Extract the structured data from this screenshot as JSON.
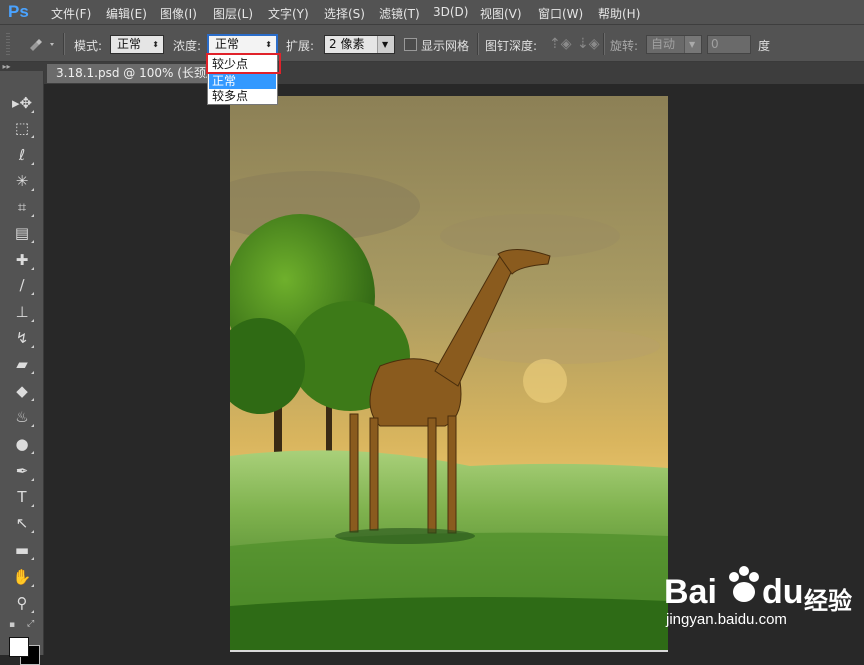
{
  "app": {
    "logo_text": "Ps",
    "brand_color": "#4aa3ff"
  },
  "menu": {
    "items": [
      {
        "label": "文件(F)"
      },
      {
        "label": "编辑(E)"
      },
      {
        "label": "图像(I)"
      },
      {
        "label": "图层(L)"
      },
      {
        "label": "文字(Y)"
      },
      {
        "label": "选择(S)"
      },
      {
        "label": "滤镜(T)"
      },
      {
        "label": "3D(D)"
      },
      {
        "label": "视图(V)"
      },
      {
        "label": "窗口(W)"
      },
      {
        "label": "帮助(H)"
      }
    ]
  },
  "options": {
    "tool_icon": "pin-tool-icon",
    "mode_label": "模式:",
    "mode_value": "正常",
    "density_label": "浓度:",
    "density_value": "正常",
    "expand_label": "扩展:",
    "expand_value": "2 像素",
    "show_grid_label": "显示网格",
    "pin_depth_label": "图钉深度:",
    "rotate_label": "旋转:",
    "rotate_value": "自动",
    "angle_value": "0",
    "angle_unit": "度"
  },
  "density_dropdown": {
    "options": [
      {
        "label": "较少点",
        "highlighted_box": true
      },
      {
        "label": "正常",
        "selected": true
      },
      {
        "label": "较多点"
      }
    ],
    "highlight_color": "#e0222a",
    "selection_color": "#3399ff"
  },
  "document": {
    "tab_title": "3.18.1.psd @ 100% (长颈鹿"
  },
  "toolbar": {
    "tools": [
      {
        "name": "move-tool-icon",
        "glyph": "▸✥"
      },
      {
        "name": "marquee-tool-icon",
        "glyph": "⬚"
      },
      {
        "name": "lasso-tool-icon",
        "glyph": "ℓ"
      },
      {
        "name": "magic-wand-tool-icon",
        "glyph": "✳"
      },
      {
        "name": "crop-tool-icon",
        "glyph": "⌗"
      },
      {
        "name": "eyedropper-tool-icon",
        "glyph": "▤"
      },
      {
        "name": "healing-brush-tool-icon",
        "glyph": "✚"
      },
      {
        "name": "brush-tool-icon",
        "glyph": "∕"
      },
      {
        "name": "stamp-tool-icon",
        "glyph": "⊥"
      },
      {
        "name": "history-brush-tool-icon",
        "glyph": "↯"
      },
      {
        "name": "eraser-tool-icon",
        "glyph": "▰"
      },
      {
        "name": "paint-bucket-tool-icon",
        "glyph": "◆"
      },
      {
        "name": "blur-tool-icon",
        "glyph": "♨"
      },
      {
        "name": "dodge-tool-icon",
        "glyph": "●"
      },
      {
        "name": "pen-tool-icon",
        "glyph": "✒"
      },
      {
        "name": "type-tool-icon",
        "glyph": "T"
      },
      {
        "name": "path-selection-tool-icon",
        "glyph": "↖"
      },
      {
        "name": "rectangle-tool-icon",
        "glyph": "▬"
      },
      {
        "name": "hand-tool-icon",
        "glyph": "✋"
      },
      {
        "name": "zoom-tool-icon",
        "glyph": "⚲"
      }
    ],
    "foreground_color": "#ffffff",
    "background_color": "#000000"
  },
  "watermark": {
    "brand": "Bai",
    "brand2": "du",
    "cn": "经验",
    "url": "jingyan.baidu.com"
  }
}
